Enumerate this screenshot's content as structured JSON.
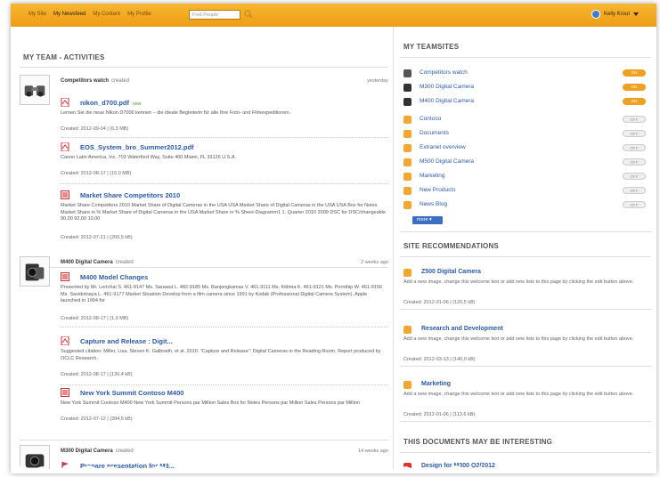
{
  "topnav": {
    "items": [
      {
        "label": "My Site",
        "active": false
      },
      {
        "label": "My Newsfeed",
        "active": true
      },
      {
        "label": "My Content",
        "active": false
      },
      {
        "label": "My Profile",
        "active": false
      }
    ],
    "search_placeholder": "Find People",
    "user_name": "Kelly Krout"
  },
  "left": {
    "title": "MY TEAM - ACTIVITIES",
    "groups": [
      {
        "name": "Competitors watch",
        "action": "created",
        "time": "yesterday",
        "docs": [
          {
            "icon": "pdf-icon",
            "title": "nikon_d700.pdf",
            "badge": "new",
            "desc": "Lernen Sie die neue Nikon D7000 kennen – die ideale Begleiterin für alle Ihre Foto- und Filmexpeditionen.",
            "meta": "Created: 2012-09-04 | (6,3 MB)"
          },
          {
            "icon": "pdf-icon",
            "title": "EOS_System_bro_Summer2012.pdf",
            "badge": "",
            "desc": "Canon Latin America, Inc. 703 Waterford Way, Suite 400 Miami, FL 33126 U.S.A.",
            "meta": "Created: 2012-08-17 | (15,0 MB)"
          },
          {
            "icon": "word-icon",
            "title": "Market Share Competitors 2010",
            "badge": "",
            "desc": "Market Share Competitors 2010 Market Share of Digital Cameras in the USA USA Market Share of Digital Cameras in the USA USA Box for Notes Market Share in % Market Share of Digital Cameras in the USA Market Share in % Sheet-Diagramm1 1. Quarter 2010 2009 DSC for DSC/changeable 90,00 92,00 10,00",
            "meta": "Created: 2012-07-21 | (200,5 kB)"
          }
        ]
      },
      {
        "name": "M400 Digital Camera",
        "action": "created",
        "time": "2 weeks ago",
        "docs": [
          {
            "icon": "word-icon",
            "title": "M400 Model Changes",
            "badge": "",
            "desc": "Presented by Mr. Lertchai S. 461-9147 Ms. Sarawut L. 482-9185 Ms. Banjongkamas V. 461-9111 Ms. Kittima K. 461-9121 Ms. Pornthip W. 461-9156 Ms. Savidotnaya L. 461-9177 Market Situation Develop from a film camera since 1991 by Kodak (Professional Digital Camera System). Apple launched in 1994 for",
            "meta": "Created: 2012-08-17 | (1,9 MB)"
          },
          {
            "icon": "pdf-icon",
            "title": "Capture and Release : Digit...",
            "badge": "",
            "desc": "Suggested citation: Miller, Lisa, Steven K. Galbraith, et al. 2010. \"Capture and Release\": Digital Cameras in the Reading Room. Report produced by OCLC Research.",
            "meta": "Created: 2012-08-17 | (136,4 kB)"
          },
          {
            "icon": "word-icon",
            "title": "New York Summit Contoso M400",
            "badge": "",
            "desc": "New York Summit Contoso M400 New York Summit Persons par Million Sales Box for Notes Persons par Million Sales Persons par Million",
            "meta": "Created: 2012-07-12 | (284,5 kB)"
          }
        ]
      },
      {
        "name": "M300 Digital Camera",
        "action": "created",
        "time": "14 weeks ago",
        "docs": [
          {
            "icon": "flag-icon",
            "title": "Prepare presentation for M3...",
            "badge": "",
            "desc": "",
            "meta": ""
          }
        ]
      }
    ]
  },
  "right": {
    "teamsites_title": "MY TEAMSITES",
    "teamsites": [
      {
        "label": "Competitors watch",
        "icon": "binoculars-icon",
        "state": "ON",
        "color": "#555555"
      },
      {
        "label": "M300 Digital Camera",
        "icon": "camera-icon",
        "state": "ON",
        "color": "#333333"
      },
      {
        "label": "M400 Digital Camera",
        "icon": "camera-icon",
        "state": "ON",
        "color": "#333333"
      },
      {
        "label": "Contoso",
        "icon": "site-icon",
        "state": "OFF",
        "color": "#f2a830"
      },
      {
        "label": "Documents",
        "icon": "site-icon",
        "state": "OFF",
        "color": "#f2a830"
      },
      {
        "label": "Extranet overview",
        "icon": "site-icon",
        "state": "OFF",
        "color": "#f2a830"
      },
      {
        "label": "M500 Digital Camera",
        "icon": "site-icon",
        "state": "OFF",
        "color": "#f2a830"
      },
      {
        "label": "Marketing",
        "icon": "site-icon",
        "state": "OFF",
        "color": "#f2a830"
      },
      {
        "label": "New Products",
        "icon": "site-icon",
        "state": "OFF",
        "color": "#f2a830"
      },
      {
        "label": "News Blog",
        "icon": "site-icon",
        "state": "OFF",
        "color": "#f2a830"
      }
    ],
    "more_label": "more",
    "recs_title": "SITE RECOMMENDATIONS",
    "recs": [
      {
        "title": "Z500 Digital Camera",
        "desc": "Add a new image, change this welcome text or add new lists to this page by clicking the edit button above.",
        "meta": "Created: 2012-01-06 | (120,5 kB)"
      },
      {
        "title": "Research and Development",
        "desc": "Add a new image, change this welcome text or add new lists to this page by clicking the edit button above.",
        "meta": "Created: 2012-03-13 | (140,0 kB)"
      },
      {
        "title": "Marketing",
        "desc": "Add a new image, change this welcome text or add new lists to this page by clicking the edit button above.",
        "meta": "Created: 2012-01-06 | (113,6 kB)"
      }
    ],
    "interesting_title": "THIS DOCUMENTS MAY BE INTERESTING",
    "interesting_first": "Design for M300 Q2/2012"
  },
  "colors": {
    "topbar": "#f2a52a",
    "link": "#2a5aa8",
    "accent": "#f2a830"
  }
}
